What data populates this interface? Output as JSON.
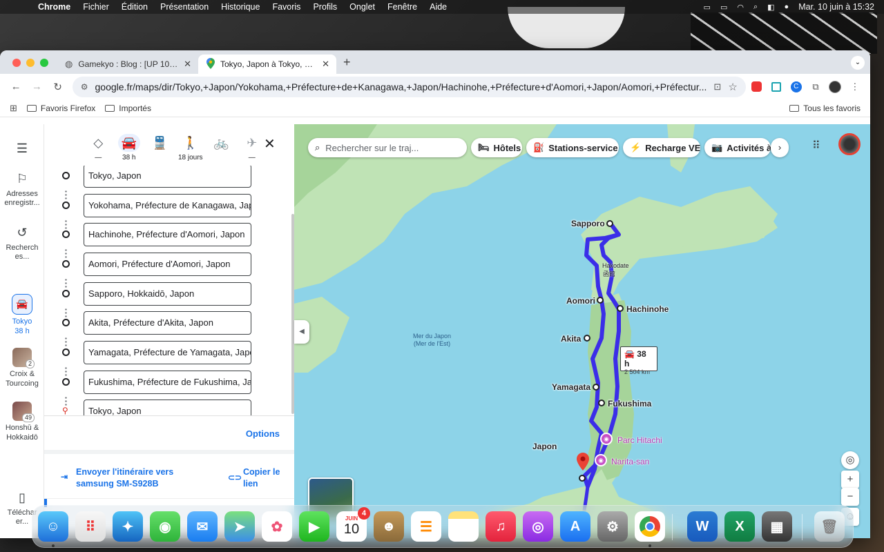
{
  "menubar": {
    "app_name": "Chrome",
    "menus": [
      "Fichier",
      "Édition",
      "Présentation",
      "Historique",
      "Favoris",
      "Profils",
      "Onglet",
      "Fenêtre",
      "Aide"
    ],
    "clock": "Mar. 10 juin à 15:32"
  },
  "browser": {
    "tabs": [
      {
        "title": "Gamekyo : Blog : [UP 10/06] I"
      },
      {
        "title": "Tokyo, Japon à Tokyo, Japon"
      }
    ],
    "url": "google.fr/maps/dir/Tokyo,+Japon/Yokohama,+Préfecture+de+Kanagawa,+Japon/Hachinohe,+Préfecture+d'Aomori,+Japon/Aomori,+Préfectur...",
    "bookmarks": {
      "firefox": "Favoris Firefox",
      "imported": "Importés",
      "all": "Tous les favoris"
    }
  },
  "rail": {
    "saved": "Adresses enregistr...",
    "recent": "Recherch es...",
    "trip": {
      "label": "Tokyo",
      "sub": "38 h"
    },
    "recent_search_1": {
      "label": "Croix & Tourcoing",
      "count": "2"
    },
    "recent_search_2": {
      "label": "Honshū & Hokkaidō",
      "count": "49"
    },
    "download": "Téléchar er..."
  },
  "directions": {
    "modes": [
      {
        "name": "best",
        "label": "—"
      },
      {
        "name": "car",
        "label": "38 h"
      },
      {
        "name": "transit",
        "label": ""
      },
      {
        "name": "walk",
        "label": "18 jours"
      },
      {
        "name": "bike",
        "label": ""
      },
      {
        "name": "flight",
        "label": "—"
      }
    ],
    "stops": [
      "Tokyo, Japon",
      "Yokohama, Préfecture de Kanagawa, Japon",
      "Hachinohe, Préfecture d'Aomori, Japon",
      "Aomori, Préfecture d'Aomori, Japon",
      "Sapporo, Hokkaidō, Japon",
      "Akita, Préfecture d'Akita, Japon",
      "Yamagata, Préfecture de Yamagata, Japon",
      "Fukushima, Préfecture de Fukushima, Japon",
      "Tokyo, Japon"
    ],
    "options": "Options",
    "send": "Envoyer l'itinéraire vers samsung SM-S928B",
    "copy": "Copier le lien"
  },
  "map": {
    "search_placeholder": "Rechercher sur le traj...",
    "chips": [
      "Hôtels",
      "Stations-service",
      "Recharge VE",
      "Activités à"
    ],
    "sea_label": "Mer du Japon\n(Mer de l'Est)",
    "cities": {
      "sapporo": "Sapporo",
      "hakodate": "Hakodate",
      "hakodate_jp": "函館",
      "aomori": "Aomori",
      "hachinohe": "Hachinohe",
      "akita": "Akita",
      "yamagata": "Yamagata",
      "fukushima": "Fukushima",
      "japon": "Japon"
    },
    "pois": [
      "Parc Hitachi",
      "Narita-san"
    ],
    "route": {
      "time": "38 h",
      "distance": "2 504 km"
    },
    "colors": {
      "route": "#3b2ee8",
      "sea": "#8dd3e8",
      "land": "#bfe3b5"
    }
  },
  "dock": {
    "calendar_month": "JUIN",
    "calendar_day": "10",
    "calendar_badge": "4"
  }
}
